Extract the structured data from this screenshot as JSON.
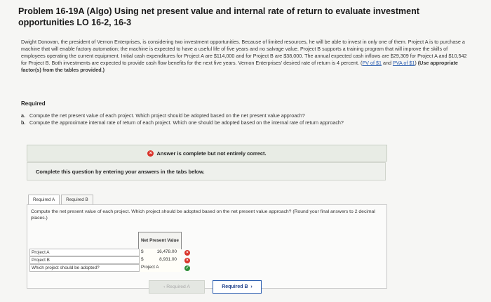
{
  "title": "Problem 16-19A (Algo) Using net present value and internal rate of return to evaluate investment opportunities LO 16-2, 16-3",
  "problem": {
    "text": "Dwight Donovan, the president of Vernon Enterprises, is considering two investment opportunities. Because of limited resources, he will be able to invest in only one of them. Project A is to purchase a machine that will enable factory automation; the machine is expected to have a useful life of five years and no salvage value. Project B supports a training program that will improve the skills of employees operating the current equipment. Initial cash expenditures for Project A are $114,000 and for Project B are $38,000. The annual expected cash inflows are $29,309 for Project A and $10,542 for Project B. Both investments are expected to provide cash flow benefits for the next five years. Vernon Enterprises' desired rate of return is 4 percent.",
    "link1": "PV of $1",
    "and": "and",
    "link2": "PVA of $1",
    "instruction": "(Use appropriate factor(s) from the tables provided.)"
  },
  "required": {
    "heading": "Required",
    "items": [
      {
        "mark": "a.",
        "text": "Compute the net present value of each project. Which project should be adopted based on the net present value approach?"
      },
      {
        "mark": "b.",
        "text": "Compute the approximate internal rate of return of each project. Which one should be adopted based on the internal rate of return approach?"
      }
    ]
  },
  "answer_status": "Answer is complete but not entirely correct.",
  "complete_prompt": "Complete this question by entering your answers in the tabs below.",
  "tabs": [
    "Required A",
    "Required B"
  ],
  "question": "Compute the net present value of each project. Which project should be adopted based on the net present value approach? (Round your final answers to 2 decimal places.)",
  "table": {
    "column_header": "Net Present Value",
    "rows": [
      {
        "label": "Project A",
        "currency": "$",
        "value": "16,478.00",
        "status": "incorrect"
      },
      {
        "label": "Project B",
        "currency": "$",
        "value": "8,931.00",
        "status": "incorrect"
      },
      {
        "label": "Which project should be adopted?",
        "currency": "",
        "value": "Project A",
        "status": "correct"
      }
    ]
  },
  "nav": {
    "prev_label": "Required A",
    "next_label": "Required B"
  },
  "colors": {
    "incorrect": "#d9342b",
    "correct": "#2f8f3a",
    "link": "#2a5db0"
  }
}
